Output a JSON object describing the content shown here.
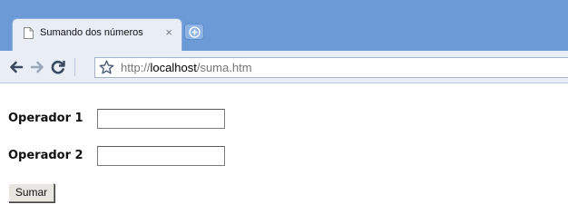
{
  "browser": {
    "tab": {
      "title": "Sumando dos números",
      "close": "×"
    },
    "address": {
      "scheme": "http://",
      "host": "localhost",
      "path": "/suma.htm"
    }
  },
  "form": {
    "operador1_label": "Operador 1",
    "operador1_value": "",
    "operador2_label": "Operador 2",
    "operador2_value": "",
    "submit_label": "Sumar"
  },
  "colors": {
    "tabstrip": "#6b9ad6",
    "toolbar": "#e9eef6"
  }
}
